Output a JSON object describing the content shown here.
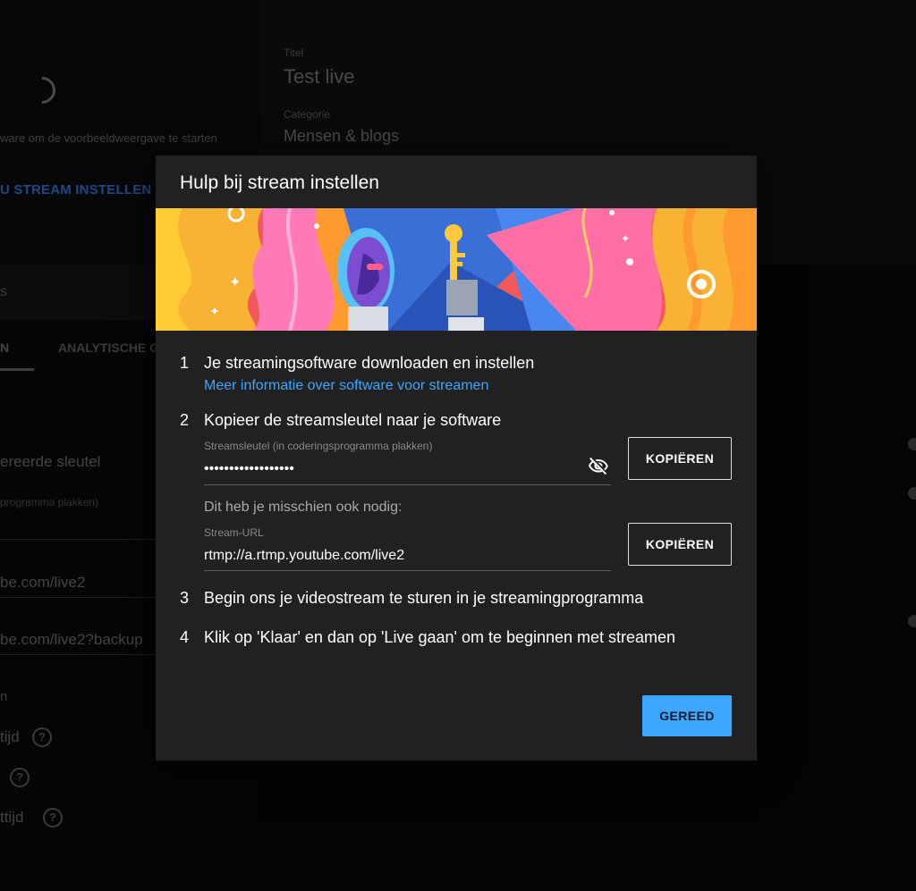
{
  "background": {
    "preview_hint": "ware om de voorbeeldweergave te starten",
    "setup_link": "U STREAM INSTELLEN",
    "section_fragment": "s",
    "tab_fragment": "N",
    "tab_analytics": "ANALYTISCHE G",
    "key_field": "ereerde sleutel",
    "key_field_hint": "programma plakken)",
    "url_field": "be.com/live2",
    "backup_url_field": "be.com/live2?backup",
    "small_fragment": "n",
    "option1": "tijd",
    "option3": "ttijd",
    "help_glyph": "?",
    "title_label": "Titel",
    "title_value": "Test live",
    "category_label": "Categorie",
    "category_value": "Mensen & blogs"
  },
  "dialog": {
    "title": "Hulp bij stream instellen",
    "steps": [
      {
        "number": "1",
        "title": "Je streamingsoftware downloaden en instellen",
        "link": "Meer informatie over software voor streamen"
      },
      {
        "number": "2",
        "title": "Kopieer de streamsleutel naar je software",
        "key_label": "Streamsleutel (in coderingsprogramma plakken)",
        "key_value": "••••••••••••••••••",
        "copy_label": "KOPIËREN",
        "extra_hint": "Dit heb je misschien ook nodig:",
        "url_label": "Stream-URL",
        "url_value": "rtmp://a.rtmp.youtube.com/live2",
        "copy_url_label": "KOPIËREN"
      },
      {
        "number": "3",
        "title": "Begin ons je videostream te sturen in je streamingprogramma"
      },
      {
        "number": "4",
        "title": "Klik op 'Klaar' en dan op 'Live gaan' om te beginnen met streamen"
      }
    ],
    "done_label": "GEREED"
  },
  "colors": {
    "accent": "#3ea6ff",
    "dialog_bg": "#212121"
  }
}
